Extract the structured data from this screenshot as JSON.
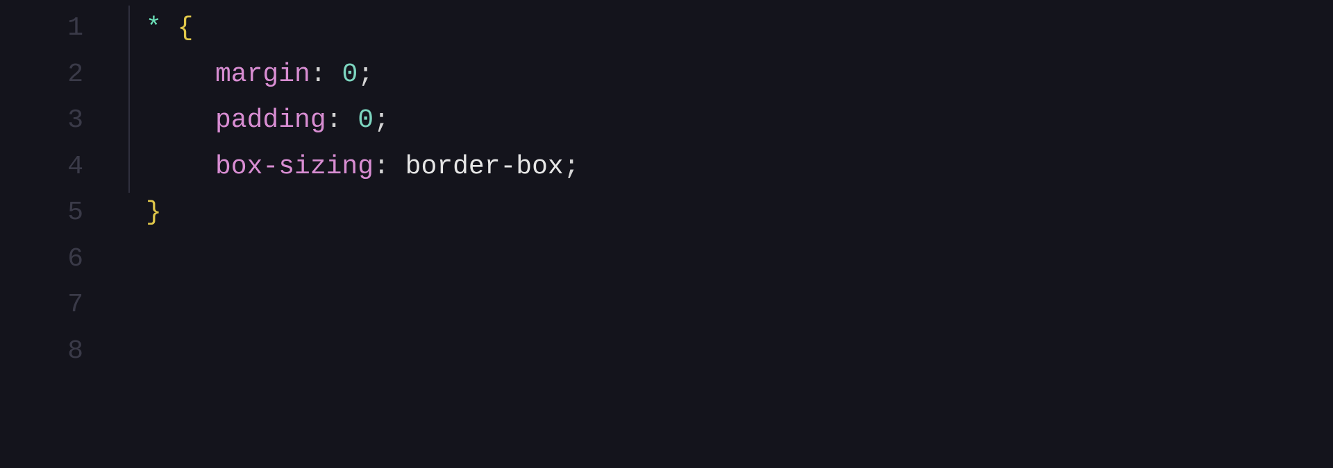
{
  "editor": {
    "lineNumbers": [
      "1",
      "2",
      "3",
      "4",
      "5",
      "6",
      "7",
      "8"
    ],
    "code": {
      "line1": {
        "selector": "*",
        "space1": " ",
        "braceOpen": "{"
      },
      "line2": {
        "prop": "margin",
        "colon": ":",
        "space": " ",
        "val": "0",
        "semi": ";"
      },
      "line3": {
        "prop": "padding",
        "colon": ":",
        "space": " ",
        "val": "0",
        "semi": ";"
      },
      "line4": {
        "prop": "box-sizing",
        "colon": ":",
        "space": " ",
        "val": "border-box",
        "semi": ";"
      },
      "line5": {
        "braceClose": "}"
      }
    }
  }
}
